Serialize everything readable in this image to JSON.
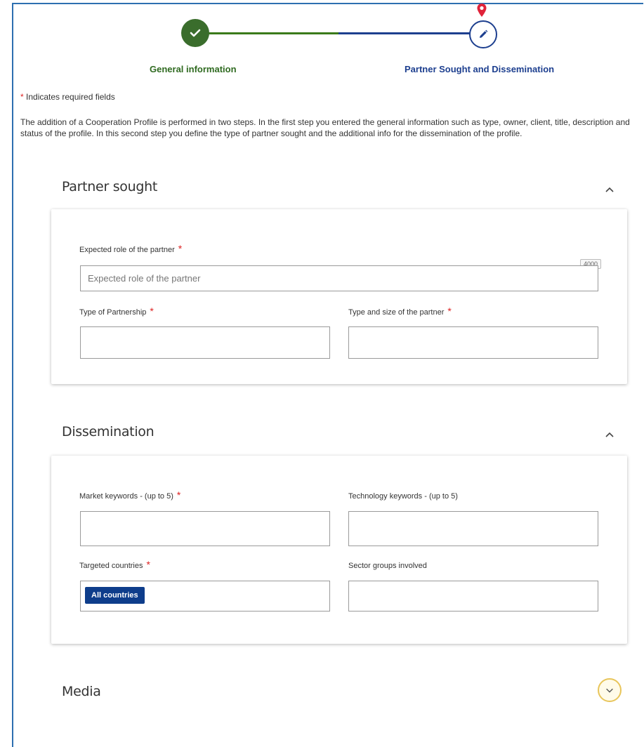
{
  "stepper": {
    "step1_label": "General information",
    "step2_label": "Partner Sought and Dissemination"
  },
  "required_note": {
    "star": "*",
    "text": "Indicates required fields"
  },
  "intro_text": "The addition of a Cooperation Profile is performed in two steps. In the first step you entered the general information such as type, owner, client, title, description and status of the profile. In this second step you define the type of partner sought and the additional info for the dissemination of the profile.",
  "partner_sought": {
    "title": "Partner sought",
    "expected_role_label": "Expected role of the partner",
    "expected_role_placeholder": "Expected role of the partner",
    "expected_role_counter": "4000",
    "type_partnership_label": "Type of Partnership",
    "type_size_label": "Type and size of the partner"
  },
  "dissemination": {
    "title": "Dissemination",
    "market_keywords_label": "Market keywords - (up to 5)",
    "technology_keywords_label": "Technology keywords - (up to 5)",
    "targeted_countries_label": "Targeted countries",
    "targeted_countries_chip": "All countries",
    "sector_groups_label": "Sector groups involved"
  },
  "media": {
    "title": "Media"
  },
  "required_star": "*",
  "icons": {
    "check": "check-icon",
    "pencil": "pencil-icon",
    "pin": "location-pin-icon",
    "chevron_up": "chevron-up-icon",
    "chevron_down": "chevron-down-icon"
  },
  "colors": {
    "done_green": "#3a6d2c",
    "active_blue": "#1d3f8f",
    "required_red": "#dd2222",
    "chip_blue": "#0e3d8b",
    "media_ring": "#e8c55a"
  }
}
